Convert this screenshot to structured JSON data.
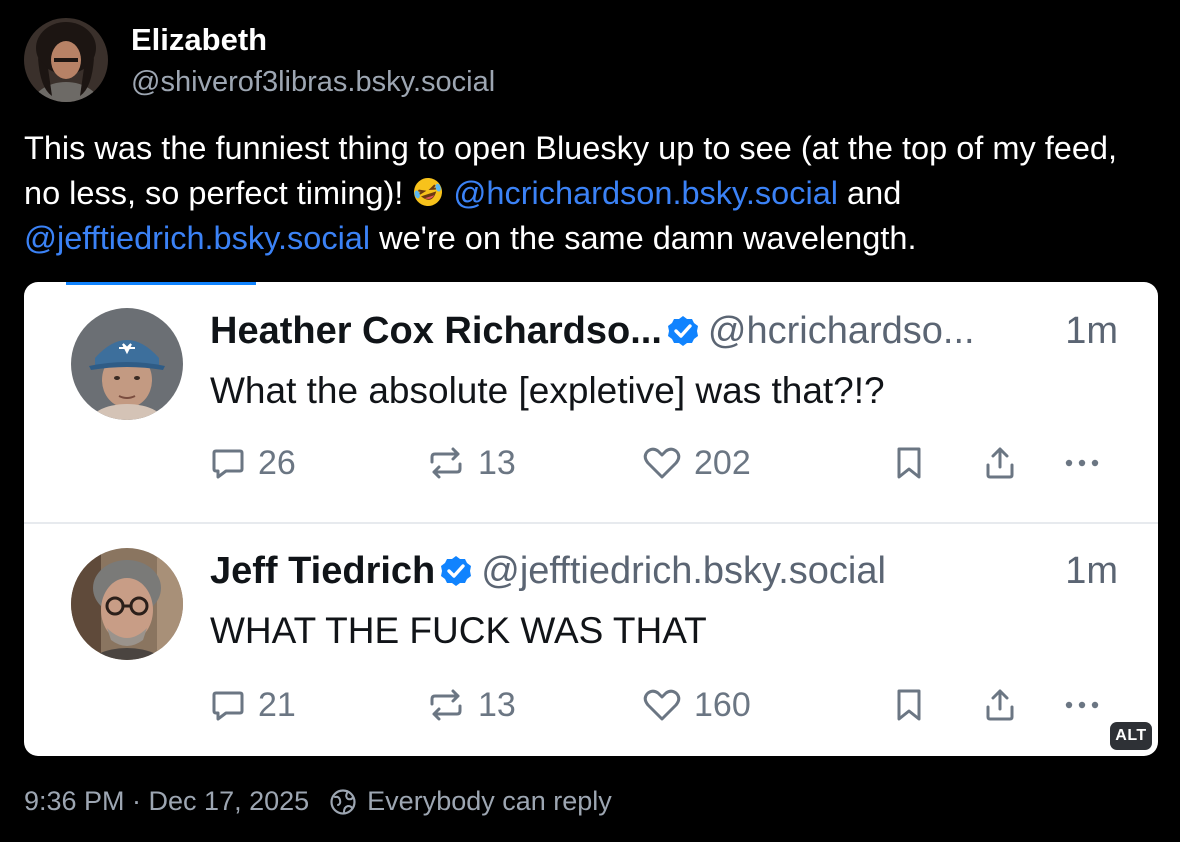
{
  "post": {
    "author": {
      "name": "Elizabeth",
      "handle": "@shiverof3libras.bsky.social"
    },
    "text": {
      "part1": "This was the funniest thing to open Bluesky up to see (at the top of my feed, no less, so perfect timing)! ",
      "mention1": "@hcrichardson.bsky.social",
      "part2": " and ",
      "mention2": "@jefftiedrich.bsky.social",
      "part3": " we're on the same damn wavelength."
    },
    "timestamp": "9:36 PM · Dec 17, 2025",
    "reply_setting": "Everybody can reply",
    "alt_badge": "ALT"
  },
  "embedded_posts": [
    {
      "name": "Heather Cox Richardso...",
      "handle": "@hcrichardso...",
      "time": "1m",
      "text": "What the absolute [expletive] was that?!?",
      "replies": "26",
      "reposts": "13",
      "likes": "202"
    },
    {
      "name": "Jeff Tiedrich",
      "handle": "@jefftiedrich.bsky.social",
      "time": "1m",
      "text": "WHAT THE FUCK WAS THAT",
      "replies": "21",
      "reposts": "13",
      "likes": "160"
    }
  ],
  "colors": {
    "background": "#000000",
    "mention": "#3b82f6",
    "verified": "#1083fe",
    "muted_text": "#9da6b2"
  },
  "icons": [
    "reply-icon",
    "repost-icon",
    "like-icon",
    "bookmark-icon",
    "share-icon",
    "more-icon",
    "verified-badge-icon",
    "globe-icon",
    "laughing-emoji-icon"
  ]
}
